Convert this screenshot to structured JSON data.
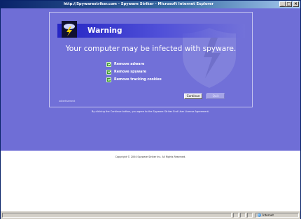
{
  "window": {
    "title": "http://Spywarestriker.com - Spyware Striker - Microsoft Internet Explorer",
    "controls": {
      "minimize": "_",
      "maximize": "□",
      "close": "×"
    }
  },
  "dialog": {
    "header_title": "Warning",
    "headline": "Your computer may be infected with spyware.",
    "items": [
      {
        "label": "Remove adware"
      },
      {
        "label": "Remove spyware"
      },
      {
        "label": "Remove tracking cookies"
      }
    ],
    "buttons": {
      "continue": "Continue",
      "quit": "Quit"
    },
    "advertisement": "advertisement"
  },
  "notice": "By clicking the Continue button, you agree to the Spyware Striker End User License Agreement.",
  "copyright": "Copyright © 2004 Spyware Striker Inc. All Rights Reserved.",
  "status": {
    "zone": "Internet"
  },
  "colors": {
    "page_bg": "#6f6ed6",
    "accent": "#2525c4",
    "check": "#3e9a2e"
  }
}
